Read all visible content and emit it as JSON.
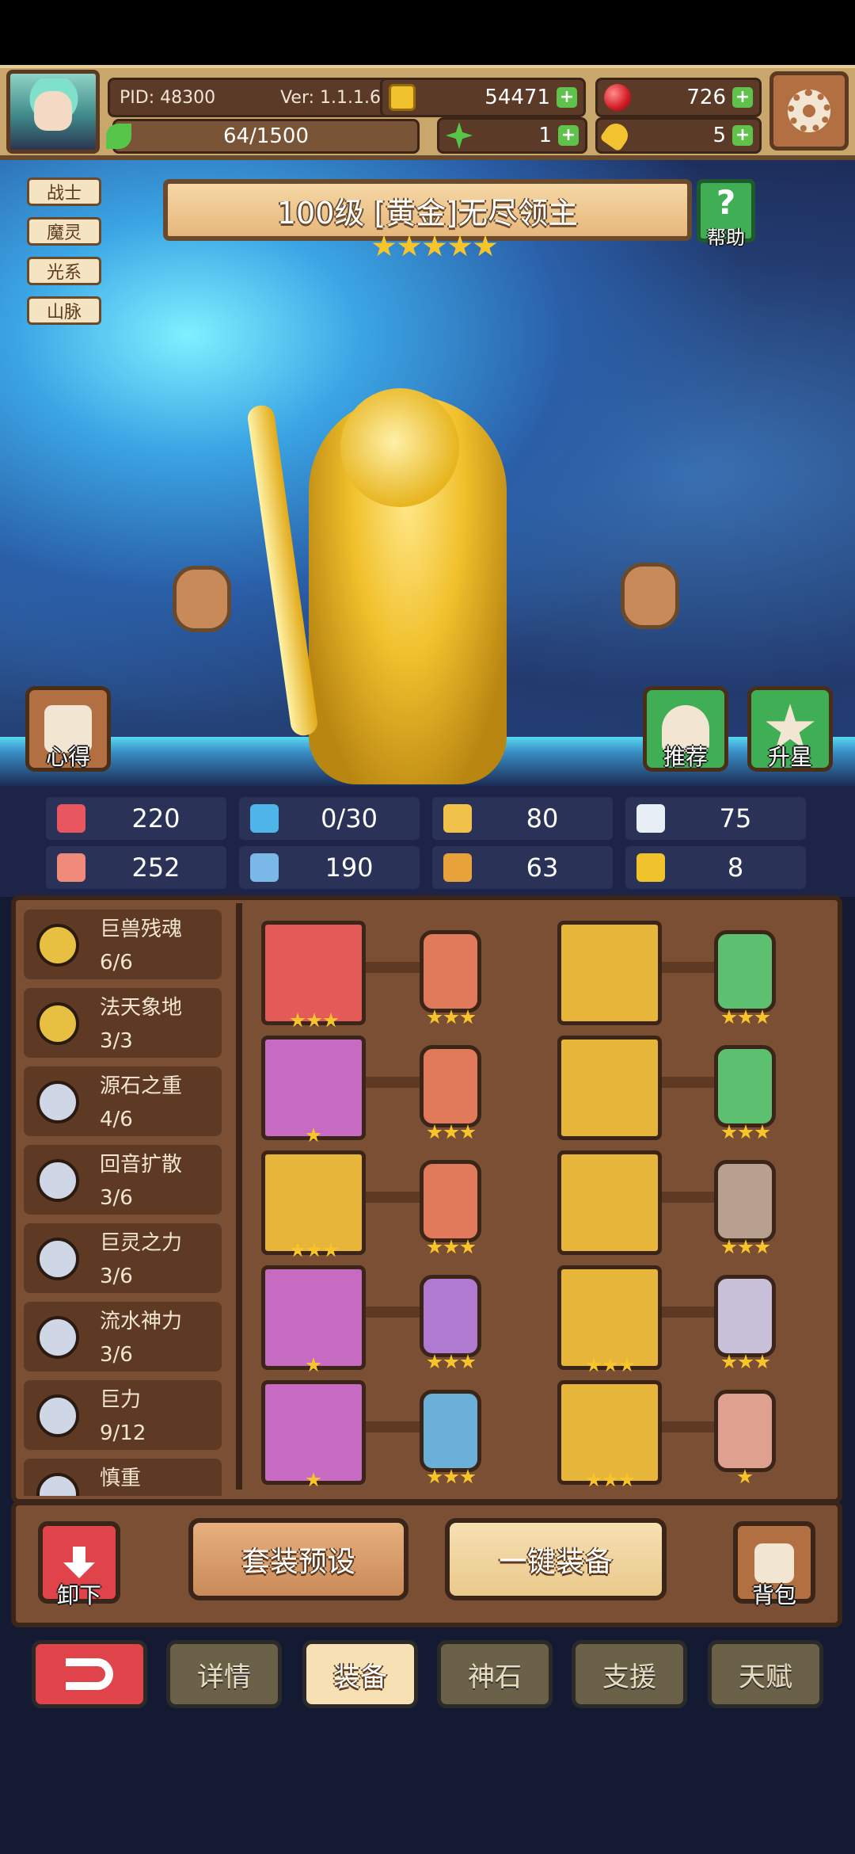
{
  "header": {
    "pid": "PID: 48300",
    "version": "Ver: 1.1.1.6",
    "gold": "54471",
    "ruby": "726",
    "xp": "64/1500",
    "clover": "1",
    "key": "5"
  },
  "class_tags": [
    "战士",
    "魔灵",
    "光系",
    "山脉"
  ],
  "title": "100级 [黄金]无尽领主",
  "title_stars": 5,
  "help_label": "帮助",
  "scene_buttons": {
    "insight": "心得",
    "recommend": "推荐",
    "star_up": "升星"
  },
  "stats": [
    {
      "icon": "heart-icon",
      "value": "220",
      "color": "#e8575f"
    },
    {
      "icon": "mana-drop-icon",
      "value": "0/30",
      "color": "#4fb5e8"
    },
    {
      "icon": "shield-icon",
      "value": "80",
      "color": "#f0c24a"
    },
    {
      "icon": "wing-icon",
      "value": "75",
      "color": "#e8eef5"
    },
    {
      "icon": "fist-icon",
      "value": "252",
      "color": "#f08a7a"
    },
    {
      "icon": "book-icon",
      "value": "190",
      "color": "#7ab8e8"
    },
    {
      "icon": "speed-icon",
      "value": "63",
      "color": "#e8a23a"
    },
    {
      "icon": "horseshoe-icon",
      "value": "8",
      "color": "#f0c22c"
    }
  ],
  "sets": [
    {
      "name": "巨兽残魂",
      "count": "6/6",
      "color": "#e7c041"
    },
    {
      "name": "法天象地",
      "count": "3/3",
      "color": "#e7c041"
    },
    {
      "name": "源石之重",
      "count": "4/6",
      "color": "#cfd6e6"
    },
    {
      "name": "回音扩散",
      "count": "3/6",
      "color": "#cfd6e6"
    },
    {
      "name": "巨灵之力",
      "count": "3/6",
      "color": "#cfd6e6"
    },
    {
      "name": "流水神力",
      "count": "3/6",
      "color": "#cfd6e6"
    },
    {
      "name": "巨力",
      "count": "9/12",
      "color": "#cfd6e6"
    },
    {
      "name": "慎重",
      "count": "",
      "color": "#cfd6e6"
    }
  ],
  "equipment_left": [
    {
      "item": "staff",
      "rarity": "red",
      "item_stars": 3,
      "gem_stars": 3,
      "gem_color": "#e07a5a"
    },
    {
      "item": "orb",
      "rarity": "pink",
      "item_stars": 1,
      "gem_stars": 3,
      "gem_color": "#e07a5a"
    },
    {
      "item": "amulet",
      "rarity": "gold",
      "item_stars": 3,
      "gem_stars": 3,
      "gem_color": "#e07a5a"
    },
    {
      "item": "ring",
      "rarity": "pink",
      "item_stars": 1,
      "gem_stars": 3,
      "gem_color": "#b07ad0"
    },
    {
      "item": "helmet",
      "rarity": "pink",
      "item_stars": 1,
      "gem_stars": 3,
      "gem_color": "#6ab0d8"
    }
  ],
  "equipment_right": [
    {
      "item": "mask",
      "rarity": "gold",
      "item_stars": 0,
      "gem_stars": 3,
      "gem_color": "#5cc070"
    },
    {
      "item": "armor",
      "rarity": "gold",
      "item_stars": 0,
      "gem_stars": 3,
      "gem_color": "#5cc070"
    },
    {
      "item": "gauntlet",
      "rarity": "gold",
      "item_stars": 0,
      "gem_stars": 3,
      "gem_color": "#b8a090"
    },
    {
      "item": "belt",
      "rarity": "gold",
      "item_stars": 3,
      "gem_stars": 3,
      "gem_color": "#c8c0d8"
    },
    {
      "item": "boots",
      "rarity": "gold",
      "item_stars": 3,
      "gem_stars": 1,
      "gem_color": "#e0a090"
    }
  ],
  "actions": {
    "unequip": "卸下",
    "preset": "套装预设",
    "equip_all": "一键装备",
    "bag": "背包"
  },
  "tabs": [
    "详情",
    "装备",
    "神石",
    "支援",
    "天赋"
  ],
  "active_tab": "装备"
}
